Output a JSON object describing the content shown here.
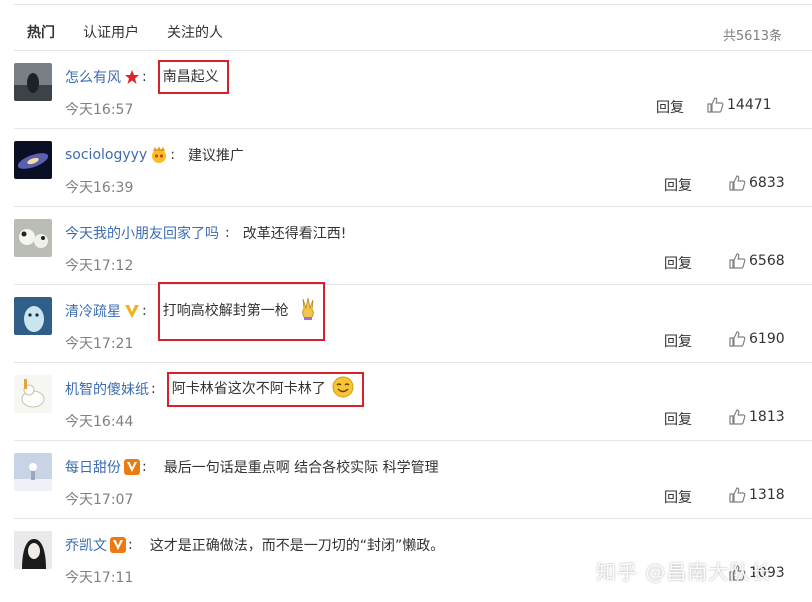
{
  "tabs": [
    "热门",
    "认证用户",
    "关注的人"
  ],
  "total_label": "共5613条",
  "comments": [
    {
      "name": "怎么有风",
      "badge": "red-star-icon",
      "text": "南昌起义",
      "boxed": true,
      "time": "今天16:57",
      "reply": "回复",
      "likes": "14471"
    },
    {
      "name": "sociologyyy",
      "badge": "crown-face-icon",
      "text": "建议推广",
      "boxed": false,
      "time": "今天16:39",
      "reply": "回复",
      "likes": "6833"
    },
    {
      "name": "今天我的小朋友回家了吗",
      "badge": "",
      "text": "改革还得看江西!",
      "boxed": false,
      "time": "今天17:12",
      "reply": "回复",
      "likes": "6568"
    },
    {
      "name": "清冷疏星",
      "badge": "gold-v-icon",
      "text": "打响高校解封第一枪",
      "boxed": true,
      "emoji": "victory-hand-emoji",
      "time": "今天17:21",
      "reply": "回复",
      "likes": "6190"
    },
    {
      "name": "机智的傻妹纸",
      "badge": "",
      "text": "阿卡林省这次不阿卡林了",
      "boxed": true,
      "emoji": "smile-face-emoji",
      "time": "今天16:44",
      "reply": "回复",
      "likes": "1813"
    },
    {
      "name": "每日甜份",
      "badge": "orange-v-icon",
      "text": "最后一句话是重点啊 结合各校实际 科学管理",
      "boxed": false,
      "time": "今天17:07",
      "reply": "回复",
      "likes": "1318"
    },
    {
      "name": "乔凯文",
      "badge": "orange-v-icon",
      "text": "这才是正确做法，而不是一刀切的“封闭”懒政。",
      "boxed": false,
      "time": "今天17:11",
      "reply": "回复",
      "likes": "1093"
    }
  ],
  "watermark": "知乎 @昌南大队长"
}
